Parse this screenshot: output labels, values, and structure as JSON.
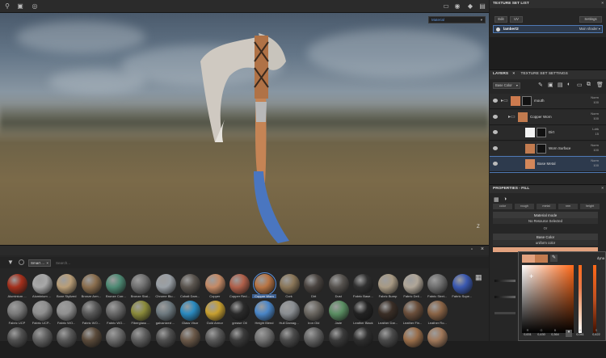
{
  "viewport": {
    "shader_dropdown": "Material",
    "axis_label": "Z"
  },
  "shelf": {
    "filter_tag": "Smart ...",
    "search_placeholder": "Search...",
    "rows": [
      [
        {
          "label": "Aluminium ...",
          "color": "#a4301c"
        },
        {
          "label": "Aluminium ...",
          "color": "#a8a8a8"
        },
        {
          "label": "Bone Stylized",
          "color": "#b99e78"
        },
        {
          "label": "Bronze Arm...",
          "color": "#8a6e4e"
        },
        {
          "label": "Bronze Corr...",
          "color": "#4e8a74"
        },
        {
          "label": "Bronze Stat...",
          "color": "#707070"
        },
        {
          "label": "Chrome Blu...",
          "color": "#9aa0a6"
        },
        {
          "label": "Cobalt Dam...",
          "color": "#5a544e"
        },
        {
          "label": "Copper",
          "color": "#c48a66"
        },
        {
          "label": "Copper Red...",
          "color": "#b0604a"
        },
        {
          "label": "Copper Worn",
          "color": "#b87444",
          "selected": true
        },
        {
          "label": "Cork",
          "color": "#8a7658"
        },
        {
          "label": "Dirt",
          "color": "#4a4440"
        },
        {
          "label": "Dust",
          "color": "#56524e"
        },
        {
          "label": "Fabric Base...",
          "color": "#303030"
        },
        {
          "label": "Fabric Bump",
          "color": "#a89a84"
        },
        {
          "label": "Fabric Deli...",
          "color": "#b0a698"
        },
        {
          "label": "Fabric Stret...",
          "color": "#6e6e6e"
        },
        {
          "label": "Fabric Supe...",
          "color": "#3a58b0"
        }
      ],
      [
        {
          "label": "Fabric UCP",
          "color": "#7a7a7a"
        },
        {
          "label": "Fabric UCP...",
          "color": "#8e8e8e"
        },
        {
          "label": "Fabric WO...",
          "color": "#909090"
        },
        {
          "label": "Fabric WO...",
          "color": "#585858"
        },
        {
          "label": "Fabric WO...",
          "color": "#686868"
        },
        {
          "label": "Fiberglass ...",
          "color": "#8a8a3a"
        },
        {
          "label": "galvanized ...",
          "color": "#6e7a80"
        },
        {
          "label": "Glass Visor",
          "color": "#2a8ac0"
        },
        {
          "label": "Gold Armor",
          "color": "#c8a030"
        },
        {
          "label": "grease Oil",
          "color": "#2a2a2a"
        },
        {
          "label": "Height Blend",
          "color": "#4a86c8"
        },
        {
          "label": "Hull Damag...",
          "color": "#8a8e92"
        },
        {
          "label": "Iron Old",
          "color": "#6a6660"
        },
        {
          "label": "Jade",
          "color": "#5a8e62"
        },
        {
          "label": "Leather Black",
          "color": "#222222"
        },
        {
          "label": "Leather Dar...",
          "color": "#3a2e26"
        },
        {
          "label": "Leather Fin...",
          "color": "#6a4e3a"
        },
        {
          "label": "Leather Ro...",
          "color": "#8a6446"
        }
      ],
      [
        {
          "label": "",
          "color": "#505050"
        },
        {
          "label": "",
          "color": "#606060"
        },
        {
          "label": "",
          "color": "#585858"
        },
        {
          "label": "",
          "color": "#5a4a3a"
        },
        {
          "label": "",
          "color": "#6a6a6a"
        },
        {
          "label": "",
          "color": "#5e5e5e"
        },
        {
          "label": "",
          "color": "#4e4e4e"
        },
        {
          "label": "",
          "color": "#6a5848"
        },
        {
          "label": "",
          "color": "#585858"
        },
        {
          "label": "",
          "color": "#3a3a3a"
        },
        {
          "label": "",
          "color": "#707070"
        },
        {
          "label": "",
          "color": "#4a4a4a"
        },
        {
          "label": "",
          "color": "#626262"
        },
        {
          "label": "",
          "color": "#3a3a3a"
        },
        {
          "label": "",
          "color": "#2e2e2e"
        },
        {
          "label": "",
          "color": "#4a4a4a"
        },
        {
          "label": "",
          "color": "#9a6e4a"
        },
        {
          "label": "",
          "color": "#a0785a"
        }
      ]
    ]
  },
  "texture_set_list": {
    "title": "TEXTURE SET LIST",
    "btn_a": "Edit",
    "btn_b": "UV",
    "settings_label": "Settings",
    "item_name": "lambert2",
    "item_shader": "Main shader"
  },
  "layers_panel": {
    "tab_layers": "LAYERS",
    "tab_settings": "TEXTURE SET SETTINGS",
    "channel": "Base Color",
    "layers": [
      {
        "name": "mouth",
        "blend": "Norm",
        "opacity": "100",
        "indent": 0,
        "folder": true,
        "thumb": "#cc7a4e",
        "mask": "#111"
      },
      {
        "name": "Copper Worn",
        "blend": "Norm",
        "opacity": "100",
        "indent": 1,
        "folder": true,
        "thumb": "#c27b4f",
        "mask": ""
      },
      {
        "name": "Dirt",
        "blend": "Ldrk",
        "opacity": "15",
        "indent": 2,
        "folder": false,
        "thumb": "#f2f2f2",
        "mask": "#111"
      },
      {
        "name": "Worn Surface",
        "blend": "Norm",
        "opacity": "100",
        "indent": 2,
        "folder": false,
        "thumb": "#c27b4f",
        "mask": "#111"
      },
      {
        "name": "Base Metal",
        "blend": "Norm",
        "opacity": "100",
        "indent": 2,
        "folder": false,
        "thumb": "#d4875a",
        "mask": "",
        "selected": true
      }
    ]
  },
  "properties": {
    "title": "PROPERTIES - FILL",
    "tabs": [
      "color",
      "rough",
      "metal",
      "nrm",
      "height"
    ],
    "material_mode": "Material mode",
    "no_resource": "No Resource Selected",
    "or_label": "Or",
    "base_color": "Base Color",
    "uniform_color": "uniform color"
  },
  "color_picker": {
    "dynamic_label": "dyna",
    "rgb_labels": [
      "R",
      "G",
      "B"
    ],
    "rgb_values": [
      "0,631",
      "0,430",
      "0,364"
    ],
    "hsv_labels": [
      "H",
      "S"
    ],
    "hsv_values": [
      "0,041",
      "0,422"
    ],
    "swatch_new": "#e2a27f",
    "swatch_old": "#c27b4f"
  }
}
